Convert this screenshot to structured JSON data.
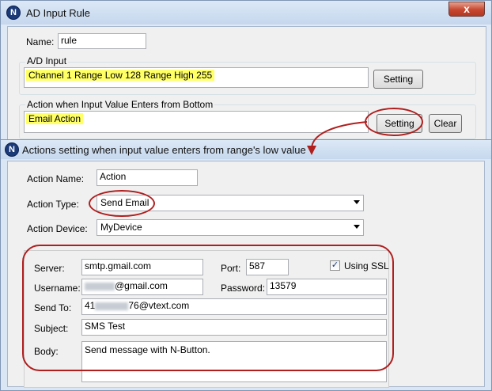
{
  "back_window": {
    "icon_letter": "N",
    "title": "AD Input Rule",
    "close_glyph": "x",
    "name_label": "Name:",
    "name_value": "rule",
    "ad_input_group": "A/D Input",
    "ad_input_value": "Channel 1  Range Low 128  Range High 255",
    "setting_button": "Setting",
    "action_group": "Action when Input Value Enters from Bottom",
    "action_value": "Email Action",
    "action_setting_button": "Setting",
    "clear_button": "Clear"
  },
  "front_window": {
    "icon_letter": "N",
    "title": "Actions setting when input value enters from range's low value",
    "action_name_label": "Action Name:",
    "action_name_value": "Action",
    "action_type_label": "Action Type:",
    "action_type_value": "Send Email",
    "action_device_label": "Action Device:",
    "action_device_value": "MyDevice",
    "email": {
      "server_label": "Server:",
      "server_value": "smtp.gmail.com",
      "port_label": "Port:",
      "port_value": "587",
      "ssl_label": "Using SSL",
      "ssl_checked": true,
      "ssl_check_glyph": "✓",
      "username_label": "Username:",
      "username_value": "@gmail.com",
      "password_label": "Password:",
      "password_value": "13579",
      "send_to_label": "Send To:",
      "send_to_prefix": "41",
      "send_to_suffix": "76@vtext.com",
      "subject_label": "Subject:",
      "subject_value": "SMS Test",
      "body_label": "Body:",
      "body_value": "Send message with N-Button."
    }
  },
  "colors": {
    "highlight": "#ffff66",
    "annotation_red": "#b01e1e",
    "title_bar": "#c5d7ee",
    "close_button": "#c7472f"
  }
}
